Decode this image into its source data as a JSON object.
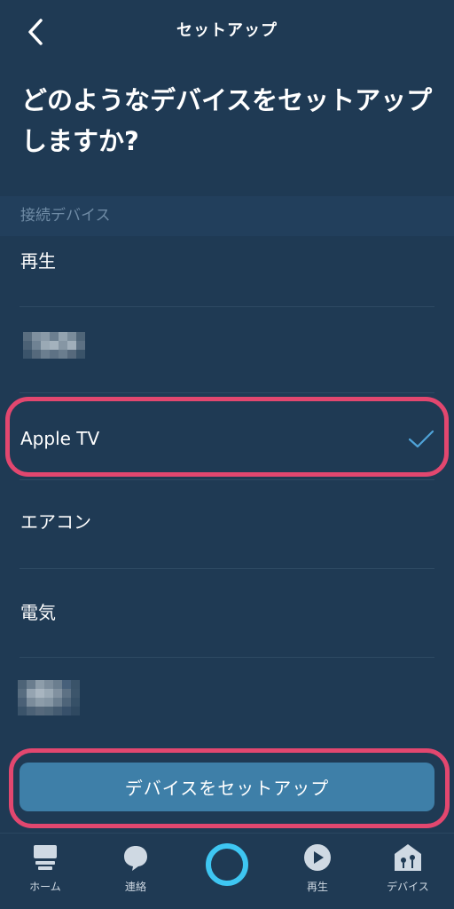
{
  "header": {
    "title": "セットアップ",
    "back_icon": "chevron-left-icon"
  },
  "headline": "どのようなデバイスをセットアップしますか?",
  "section": {
    "label": "接続デバイス"
  },
  "list": {
    "items": [
      {
        "label": "再生"
      },
      {
        "label": "",
        "redacted": true
      },
      {
        "label": "Apple TV",
        "selected": true
      },
      {
        "label": "エアコン"
      },
      {
        "label": "電気"
      },
      {
        "label": "",
        "redacted": true
      }
    ]
  },
  "setup_button": {
    "label": "デバイスをセットアップ"
  },
  "tabbar": {
    "tabs": [
      {
        "label": "ホーム",
        "icon": "home-icon"
      },
      {
        "label": "連絡",
        "icon": "chat-bubble-icon"
      },
      {
        "label": "",
        "icon": "alexa-ring-icon"
      },
      {
        "label": "再生",
        "icon": "play-circle-icon"
      },
      {
        "label": "デバイス",
        "icon": "devices-home-icon"
      }
    ]
  },
  "colors": {
    "background": "#1f3a54",
    "highlight": "#e2476f",
    "accent": "#3e7fa8",
    "check": "#4fa3d9",
    "alexa": "#3ec6f2"
  }
}
